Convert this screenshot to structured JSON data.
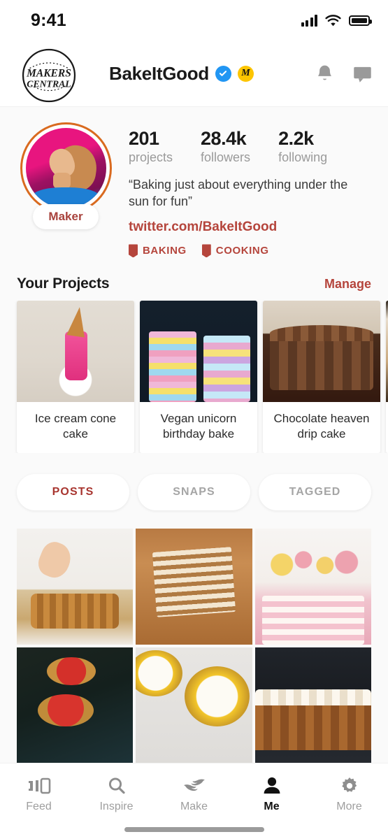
{
  "status_bar": {
    "time": "9:41",
    "signal_icon": "signal-bars-icon",
    "wifi_icon": "wifi-icon",
    "battery_icon": "battery-full-icon"
  },
  "app_bar": {
    "logo_text": "MAKERS CENTRAL",
    "logo_icon": "makers-central-logo",
    "username": "BakeItGood",
    "verified_icon": "verified-check-icon",
    "maker_badge_icon": "makers-m-badge-icon",
    "maker_badge_letter": "M",
    "notifications_icon": "bell-icon",
    "messages_icon": "chat-bubble-icon"
  },
  "profile": {
    "avatar_icon": "user-avatar",
    "role_badge": "Maker",
    "stats": [
      {
        "value": "201",
        "label": "projects"
      },
      {
        "value": "28.4k",
        "label": "followers"
      },
      {
        "value": "2.2k",
        "label": "following"
      }
    ],
    "bio": "“Baking just about everything under the sun for fun”",
    "link": "twitter.com/BakeItGood",
    "tags": [
      {
        "label": "BAKING",
        "icon": "ribbon-badge-icon"
      },
      {
        "label": "COOKING",
        "icon": "ribbon-badge-icon"
      }
    ]
  },
  "projects_section": {
    "title": "Your Projects",
    "action_label": "Manage",
    "cards": [
      {
        "caption": "Ice cream cone cake",
        "image": "ice-cream-cone-cake-photo"
      },
      {
        "caption": "Vegan unicorn birthday bake",
        "image": "vegan-unicorn-cake-photo"
      },
      {
        "caption": "Chocolate heaven drip cake",
        "image": "chocolate-drip-cake-photo"
      },
      {
        "caption": "",
        "image": "partial-project-photo"
      }
    ]
  },
  "tabs": [
    {
      "label": "POSTS",
      "active": true
    },
    {
      "label": "SNAPS",
      "active": false
    },
    {
      "label": "TAGGED",
      "active": false
    }
  ],
  "gallery": [
    {
      "image": "blueberry-drip-cake-photo"
    },
    {
      "image": "layered-honey-cake-photo"
    },
    {
      "image": "macaron-drip-cake-photo"
    },
    {
      "image": "berry-tartlets-dark-photo"
    },
    {
      "image": "lemon-blackberry-tarts-photo"
    },
    {
      "image": "piping-cream-cake-photo"
    }
  ],
  "bottom_nav": [
    {
      "label": "Feed",
      "icon": "cards-feed-icon",
      "active": false
    },
    {
      "label": "Inspire",
      "icon": "search-icon",
      "active": false
    },
    {
      "label": "Make",
      "icon": "hands-make-icon",
      "active": false
    },
    {
      "label": "Me",
      "icon": "person-icon",
      "active": true
    },
    {
      "label": "More",
      "icon": "gear-icon",
      "active": false
    }
  ],
  "colors": {
    "accent_red": "#b5453c",
    "avatar_ring": "#d96a1f",
    "verified_blue": "#2196f3",
    "maker_yellow": "#fdc500",
    "background": "#fafafa"
  }
}
